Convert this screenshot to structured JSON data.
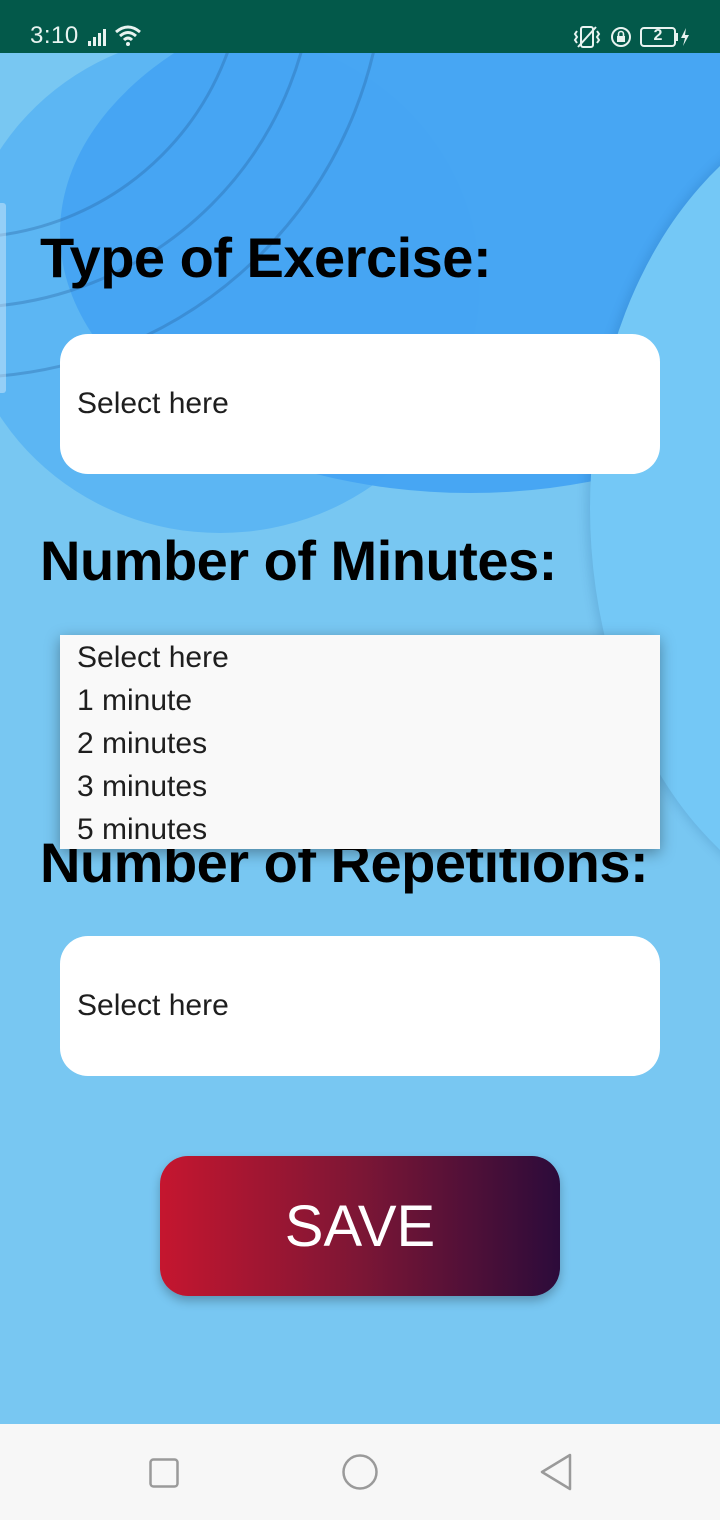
{
  "status_bar": {
    "time": "3:10",
    "battery_level": "2",
    "icons": [
      "signal-icon",
      "wifi-icon",
      "vibrate-icon",
      "rotation-lock-icon",
      "battery-icon",
      "charging-icon"
    ],
    "background": "#03594a"
  },
  "form": {
    "exercise": {
      "heading": "Type of Exercise:",
      "value": "Select here"
    },
    "minutes": {
      "heading": "Number of Minutes:",
      "options": [
        "Select here",
        "1 minute",
        "2 minutes",
        "3 minutes",
        "5 minutes"
      ]
    },
    "repetitions": {
      "heading": "Number of Repetitions:",
      "value": "Select here"
    },
    "save_label": "SAVE"
  },
  "colors": {
    "background": "#78c7f2",
    "save_gradient_start": "#c5162f",
    "save_gradient_end": "#2c0b3a"
  },
  "nav_bar": {
    "icons": [
      "recent-apps-icon",
      "home-icon",
      "back-icon"
    ]
  }
}
